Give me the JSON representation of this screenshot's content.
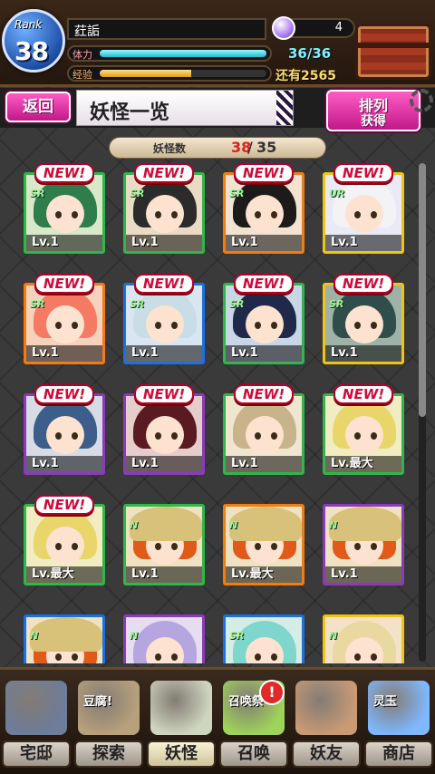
{
  "header": {
    "rank_label": "Rank",
    "rank_value": "38",
    "player_name": "荭詬",
    "stamina_label": "体力",
    "stamina_value": "36/36",
    "stamina_fraction": 1.0,
    "exp_label": "经验",
    "exp_value": "还有2565",
    "exp_fraction": 0.55,
    "gem_count": "4"
  },
  "title_bar": {
    "back_label": "返回",
    "title": "妖怪一览",
    "sort_line1": "排列",
    "sort_line2": "获得"
  },
  "counter": {
    "label": "妖怪数",
    "current": "38",
    "separator": "/",
    "max": "35"
  },
  "cards": [
    {
      "new": "NEW!",
      "rarity": "SR",
      "level": "Lv.1",
      "frame": "#32b54a",
      "bg": "#d9e8c9",
      "hair": "#2e7d4a",
      "hat": false
    },
    {
      "new": "NEW!",
      "rarity": "SR",
      "level": "Lv.1",
      "frame": "#32b54a",
      "bg": "#eadcc4",
      "hair": "#2b2b2b",
      "hat": false
    },
    {
      "new": "NEW!",
      "rarity": "SR",
      "level": "Lv.1",
      "frame": "#f07d14",
      "bg": "#f2e2d2",
      "hair": "#1d1a1a",
      "hat": false
    },
    {
      "new": "NEW!",
      "rarity": "UR",
      "level": "Lv.1",
      "frame": "#f0c414",
      "bg": "#e9eaf5",
      "hair": "#f2f2f7",
      "hat": false
    },
    {
      "new": "NEW!",
      "rarity": "SR",
      "level": "Lv.1",
      "frame": "#f07d14",
      "bg": "#f6d2bd",
      "hair": "#f57a63",
      "hat": false
    },
    {
      "new": "NEW!",
      "rarity": "SR",
      "level": "Lv.1",
      "frame": "#1e6fe0",
      "bg": "#d9e6f2",
      "hair": "#c8dde6",
      "hat": false
    },
    {
      "new": "NEW!",
      "rarity": "SR",
      "level": "Lv.1",
      "frame": "#32b54a",
      "bg": "#c9d6e6",
      "hair": "#1f2a4a",
      "hat": false
    },
    {
      "new": "NEW!",
      "rarity": "SR",
      "level": "Lv.1",
      "frame": "#f0c414",
      "bg": "#9fb2a8",
      "hair": "#2f4d4a",
      "hat": false
    },
    {
      "new": "NEW!",
      "rarity": "",
      "level": "Lv.1",
      "frame": "#8b3bb8",
      "bg": "#d6dbe6",
      "hair": "#3d5d8a",
      "hat": false
    },
    {
      "new": "NEW!",
      "rarity": "",
      "level": "Lv.1",
      "frame": "#8b3bb8",
      "bg": "#e6cccc",
      "hair": "#5a1a22",
      "hat": false
    },
    {
      "new": "NEW!",
      "rarity": "",
      "level": "Lv.1",
      "frame": "#32b54a",
      "bg": "#f0e6d0",
      "hair": "#c7b48a",
      "hat": false
    },
    {
      "new": "NEW!",
      "rarity": "",
      "level": "Lv.最大",
      "frame": "#32b54a",
      "bg": "#f2ecc2",
      "hair": "#e8d66b",
      "hat": false
    },
    {
      "new": "NEW!",
      "rarity": "",
      "level": "Lv.最大",
      "frame": "#32b54a",
      "bg": "#f2ecc2",
      "hair": "#e8d66b",
      "hat": false
    },
    {
      "new": "",
      "rarity": "N",
      "level": "Lv.1",
      "frame": "#32b54a",
      "bg": "#efe2c2",
      "hair": "#e25a1a",
      "hat": true
    },
    {
      "new": "",
      "rarity": "N",
      "level": "Lv.最大",
      "frame": "#f07d14",
      "bg": "#efe2c2",
      "hair": "#e25a1a",
      "hat": true
    },
    {
      "new": "",
      "rarity": "N",
      "level": "Lv.1",
      "frame": "#8b3bb8",
      "bg": "#efe2c2",
      "hair": "#e25a1a",
      "hat": true
    },
    {
      "new": "",
      "rarity": "N",
      "level": "",
      "frame": "#1e6fe0",
      "bg": "#efe2c2",
      "hair": "#e25a1a",
      "hat": true
    },
    {
      "new": "",
      "rarity": "N",
      "level": "",
      "frame": "#8b3bb8",
      "bg": "#e6def0",
      "hair": "#b6a6e0",
      "hat": false
    },
    {
      "new": "",
      "rarity": "SR",
      "level": "",
      "frame": "#1e6fe0",
      "bg": "#d6ece6",
      "hair": "#7fd6cc",
      "hat": false
    },
    {
      "new": "",
      "rarity": "N",
      "level": "",
      "frame": "#f0c414",
      "bg": "#f4e2c8",
      "hair": "#e9d8a0",
      "hat": false
    }
  ],
  "bottom_nav": [
    {
      "label": "宅邸",
      "tag": "",
      "icon": "house-icon",
      "color": "#6d7d9a"
    },
    {
      "label": "探索",
      "tag": "豆腐!",
      "icon": "tofu-icon",
      "color": "#b8a07a"
    },
    {
      "label": "妖怪",
      "tag": "",
      "icon": "scroll-icon",
      "color": "#cfd6c0"
    },
    {
      "label": "召唤",
      "tag": "召唤祭",
      "icon": "summon-icon",
      "color": "#9fd45a"
    },
    {
      "label": "妖友",
      "tag": "",
      "icon": "friend-icon",
      "color": "#c99a74"
    },
    {
      "label": "商店",
      "tag": "灵玉",
      "icon": "orb-icon",
      "color": "#7fb8ff"
    }
  ],
  "alert_badge": "!"
}
